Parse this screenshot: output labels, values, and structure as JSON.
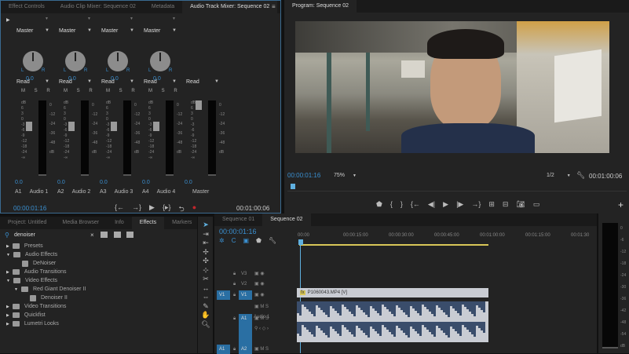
{
  "mixer_panel": {
    "tabs": [
      "Effect Controls",
      "Audio Clip Mixer: Sequence 02",
      "Metadata",
      "Audio Track Mixer: Sequence 02"
    ],
    "active_tab": 3,
    "channels": [
      {
        "output": "Master",
        "automation": "Read",
        "pan": "0.0",
        "volume": "0.0",
        "track": "A1",
        "name": "Audio 1"
      },
      {
        "output": "Master",
        "automation": "Read",
        "pan": "0.0",
        "volume": "0.0",
        "track": "A2",
        "name": "Audio 2"
      },
      {
        "output": "Master",
        "automation": "Read",
        "pan": "0.0",
        "volume": "0.0",
        "track": "A3",
        "name": "Audio 3"
      },
      {
        "output": "Master",
        "automation": "Read",
        "pan": "0.0",
        "volume": "0.0",
        "track": "A4",
        "name": "Audio 4"
      }
    ],
    "master": {
      "automation": "Read",
      "volume": "0.0",
      "name": "Master"
    },
    "fader_scale": [
      "dB",
      "6",
      "3",
      "0",
      "-3",
      "-6",
      "-9",
      "-12",
      "-18",
      "-24",
      "-∞"
    ],
    "meter_scale": [
      "0",
      "-12",
      "-24",
      "-36",
      "-48",
      "dB"
    ],
    "msr": "M S R",
    "timecode_current": "00:00:01:16",
    "timecode_duration": "00:01:00:06"
  },
  "program_monitor": {
    "title": "Program: Sequence 02",
    "timecode_current": "00:00:01:16",
    "zoom": "75%",
    "resolution": "1/2",
    "timecode_duration": "00:01:00:06"
  },
  "effects_panel": {
    "tabs": [
      "Project: Untitled",
      "Media Browser",
      "Info",
      "Effects",
      "Markers"
    ],
    "active_tab": 3,
    "search_value": "denoiser",
    "tree": [
      {
        "label": "Presets",
        "level": 0,
        "expanded": false,
        "type": "folder"
      },
      {
        "label": "Audio Effects",
        "level": 0,
        "expanded": true,
        "type": "folder"
      },
      {
        "label": "DeNoiser",
        "level": 1,
        "type": "effect"
      },
      {
        "label": "Audio Transitions",
        "level": 0,
        "expanded": false,
        "type": "folder"
      },
      {
        "label": "Video Effects",
        "level": 0,
        "expanded": true,
        "type": "folder"
      },
      {
        "label": "Red Giant Denoiser II",
        "level": 1,
        "expanded": true,
        "type": "folder"
      },
      {
        "label": "Denoiser II",
        "level": 2,
        "type": "effect"
      },
      {
        "label": "Video Transitions",
        "level": 0,
        "expanded": false,
        "type": "folder"
      },
      {
        "label": "Quickfist",
        "level": 0,
        "expanded": false,
        "type": "folder"
      },
      {
        "label": "Lumetri Looks",
        "level": 0,
        "expanded": false,
        "type": "folder"
      }
    ]
  },
  "timeline": {
    "tabs": [
      "Sequence 01",
      "Sequence 02"
    ],
    "active_tab": 1,
    "timecode": "00:00:01:16",
    "ruler": [
      "00:00",
      "00:00:15:00",
      "00:00:30:00",
      "00:00:45:00",
      "00:01:00:00",
      "00:01:15:00",
      "00:01:30"
    ],
    "tracks": [
      {
        "src": "",
        "name": "V3"
      },
      {
        "src": "",
        "name": "V2"
      },
      {
        "src": "V1",
        "name": "V1"
      },
      {
        "src": "",
        "name": "A1",
        "label": "Audio 1"
      },
      {
        "src": "A1",
        "name": "A2"
      }
    ],
    "video_clip": "P1060043.MP4 [V]",
    "meter_scale": [
      "0",
      "-6",
      "-12",
      "-18",
      "-24",
      "-30",
      "-36",
      "-42",
      "-48",
      "-54",
      "dB"
    ]
  },
  "colors": {
    "accent": "#3a8fd0",
    "playhead": "#5fb0e0",
    "workarea": "#d8c657"
  }
}
